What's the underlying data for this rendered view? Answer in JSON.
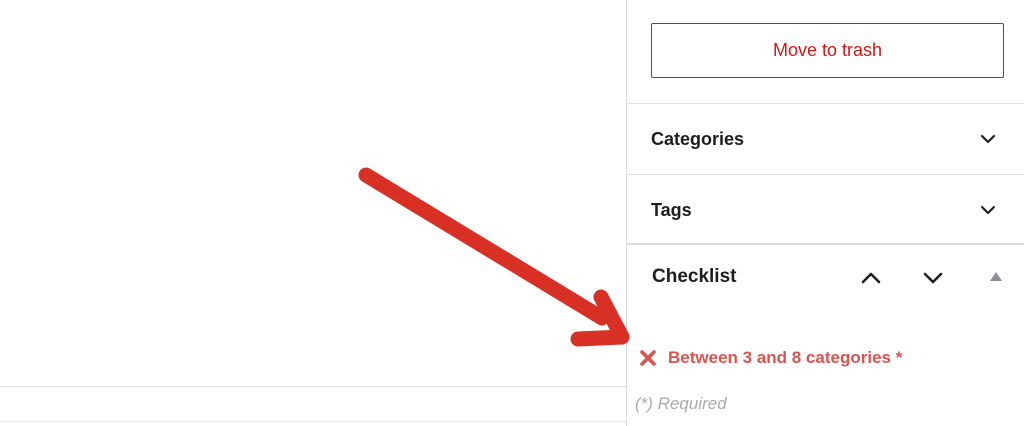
{
  "sidebar": {
    "trash_button": "Move to trash",
    "panels": [
      {
        "title": "Categories",
        "icon": "chevron-down-icon"
      },
      {
        "title": "Tags",
        "icon": "chevron-down-icon"
      }
    ],
    "checklist": {
      "title": "Checklist",
      "controls": [
        "chevron-up-icon",
        "chevron-down-icon",
        "triangle-up-icon"
      ],
      "requirement": {
        "status_icon": "x-icon",
        "text": "Between 3 and 8 categories *"
      },
      "required_note": "(*) Required"
    }
  },
  "colors": {
    "danger": "#cc1818",
    "requirement_fail": "#d9534f",
    "annotation_arrow": "#d93025"
  }
}
